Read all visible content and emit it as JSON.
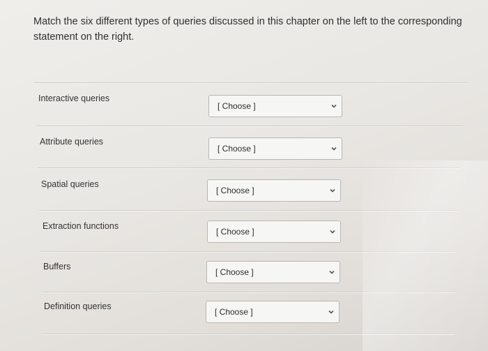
{
  "question": {
    "text": "Match the six different types of queries discussed in this chapter on the left to the corresponding statement on the right."
  },
  "rows": [
    {
      "label": "Interactive queries",
      "selected": "[ Choose ]"
    },
    {
      "label": "Attribute queries",
      "selected": "[ Choose ]"
    },
    {
      "label": "Spatial queries",
      "selected": "[ Choose ]"
    },
    {
      "label": "Extraction functions",
      "selected": "[ Choose ]"
    },
    {
      "label": "Buffers",
      "selected": "[ Choose ]"
    },
    {
      "label": "Definition queries",
      "selected": "[ Choose ]"
    }
  ],
  "icons": {
    "dropdown": "chevron-down-icon"
  }
}
